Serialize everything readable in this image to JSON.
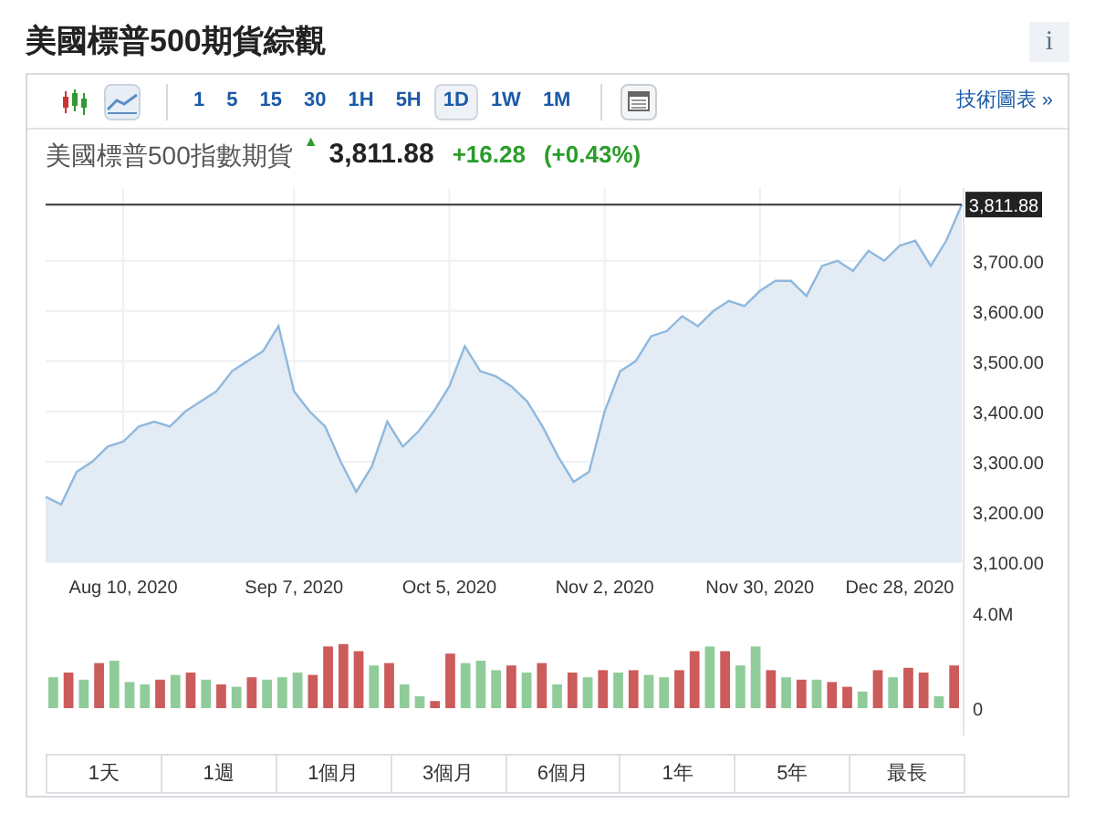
{
  "title": "美國標普500期貨綜觀",
  "info_button": "i",
  "toolbar": {
    "chart_types": [
      {
        "kind": "candlestick",
        "selected": false
      },
      {
        "kind": "line",
        "selected": true
      }
    ],
    "intervals": [
      {
        "label": "1",
        "selected": false
      },
      {
        "label": "5",
        "selected": false
      },
      {
        "label": "15",
        "selected": false
      },
      {
        "label": "30",
        "selected": false
      },
      {
        "label": "1H",
        "selected": false
      },
      {
        "label": "5H",
        "selected": false
      },
      {
        "label": "1D",
        "selected": true
      },
      {
        "label": "1W",
        "selected": false
      },
      {
        "label": "1M",
        "selected": false
      }
    ],
    "link": "技術圖表 »"
  },
  "quote": {
    "name": "美國標普500指數期貨",
    "arrow": "▲",
    "price": "3,811.88",
    "change": "+16.28",
    "change_percent": "(+0.43%)"
  },
  "price_chart": {
    "price_label": "3,811.88",
    "chart_data": {
      "type": "area",
      "categories": [
        null,
        null,
        null,
        null,
        null,
        "Aug 10, 2020",
        null,
        null,
        null,
        null,
        null,
        null,
        null,
        null,
        null,
        null,
        "Sep 7, 2020",
        null,
        null,
        null,
        null,
        null,
        null,
        null,
        null,
        null,
        "Oct 5, 2020",
        null,
        null,
        null,
        null,
        null,
        null,
        null,
        null,
        null,
        "Nov 2, 2020",
        null,
        null,
        null,
        null,
        null,
        null,
        null,
        null,
        null,
        "Nov 30, 2020",
        null,
        null,
        null,
        null,
        null,
        null,
        null,
        null,
        "Dec 28, 2020",
        null,
        null,
        null,
        null
      ],
      "series": [
        {
          "color": "#8fb8de",
          "values": [
            3230,
            3215,
            3280,
            3300,
            3330,
            3340,
            3370,
            3380,
            3370,
            3400,
            3420,
            3440,
            3480,
            3500,
            3520,
            3570,
            3440,
            3400,
            3370,
            3300,
            3240,
            3290,
            3380,
            3330,
            3360,
            3400,
            3450,
            3530,
            3480,
            3470,
            3450,
            3420,
            3370,
            3310,
            3260,
            3280,
            3400,
            3480,
            3500,
            3550,
            3560,
            3590,
            3570,
            3600,
            3620,
            3610,
            3640,
            3660,
            3660,
            3630,
            3690,
            3700,
            3680,
            3720,
            3700,
            3730,
            3740,
            3690,
            3740,
            3812
          ]
        }
      ],
      "ylim": [
        3100,
        3845
      ],
      "grid": true,
      "ref_lines": [
        {
          "axis": "y",
          "value": 3812,
          "color": "#333333"
        }
      ],
      "yticks": [
        {
          "value": 3100,
          "label": "3,100.00"
        },
        {
          "value": 3200,
          "label": "3,200.00"
        },
        {
          "value": 3300,
          "label": "3,300.00"
        },
        {
          "value": 3400,
          "label": "3,400.00"
        },
        {
          "value": 3500,
          "label": "3,500.00"
        },
        {
          "value": 3600,
          "label": "3,600.00"
        },
        {
          "value": 3700,
          "label": "3,700.00"
        }
      ]
    }
  },
  "volume_chart": {
    "chart_data": {
      "type": "bar",
      "stacked": true,
      "series": [
        {
          "color": "#8fcc99",
          "values": [
            1.3,
            null,
            1.2,
            null,
            2.0,
            1.1,
            1.0,
            null,
            1.4,
            null,
            1.2,
            null,
            0.9,
            null,
            1.2,
            1.3,
            1.5,
            null,
            null,
            null,
            null,
            1.8,
            null,
            1.0,
            0.5,
            null,
            null,
            1.9,
            2.0,
            1.6,
            null,
            1.5,
            null,
            1.0,
            null,
            1.3,
            null,
            1.5,
            null,
            1.4,
            1.3,
            null,
            null,
            2.6,
            null,
            1.8,
            2.6,
            null,
            1.3,
            null,
            1.2,
            null,
            null,
            0.7,
            null,
            1.3,
            null,
            null,
            0.5,
            null
          ]
        },
        {
          "color": "#cc5b5b",
          "values": [
            null,
            1.5,
            null,
            1.9,
            null,
            null,
            null,
            1.2,
            null,
            1.5,
            null,
            1.0,
            null,
            1.3,
            null,
            null,
            null,
            1.4,
            2.6,
            2.7,
            2.4,
            null,
            1.9,
            null,
            null,
            0.3,
            2.3,
            null,
            null,
            null,
            1.8,
            null,
            1.9,
            null,
            1.5,
            null,
            1.6,
            null,
            1.6,
            null,
            null,
            1.6,
            2.4,
            null,
            2.4,
            null,
            null,
            1.6,
            null,
            1.2,
            null,
            1.1,
            0.9,
            null,
            1.6,
            null,
            1.7,
            1.5,
            null,
            1.8
          ]
        }
      ],
      "ylim": [
        0,
        4
      ],
      "yticks": [
        0,
        {
          "value": 4,
          "label": "4.0M"
        }
      ]
    }
  },
  "ranges": [
    "1天",
    "1週",
    "1個月",
    "3個月",
    "6個月",
    "1年",
    "5年",
    "最長"
  ]
}
